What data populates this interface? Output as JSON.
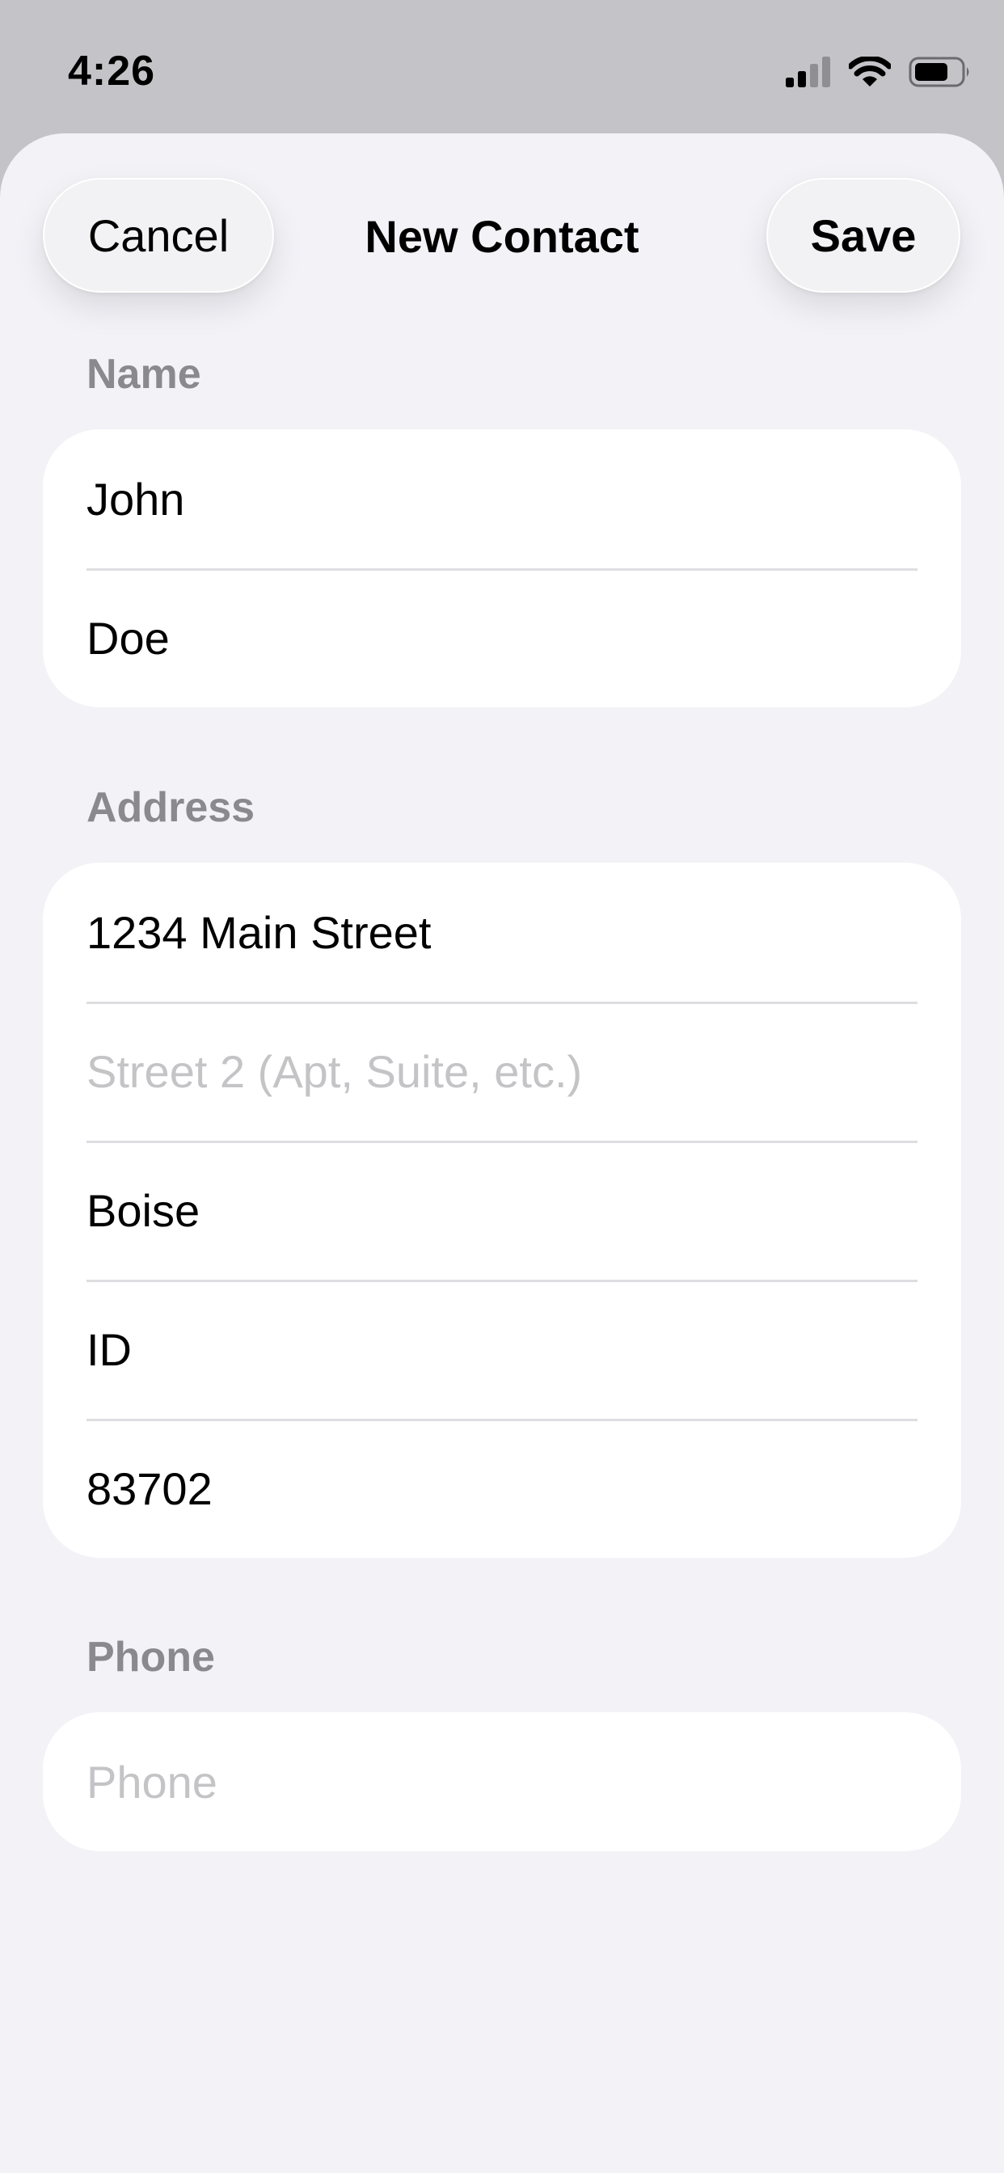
{
  "status_bar": {
    "time": "4:26",
    "icons": [
      "cellular-signal-icon",
      "wifi-icon",
      "battery-icon"
    ]
  },
  "nav": {
    "cancel_label": "Cancel",
    "title": "New Contact",
    "save_label": "Save"
  },
  "sections": {
    "name": {
      "header": "Name",
      "first_name": {
        "value": "John",
        "placeholder": ""
      },
      "last_name": {
        "value": "Doe",
        "placeholder": ""
      }
    },
    "address": {
      "header": "Address",
      "street1": {
        "value": "1234 Main Street",
        "placeholder": ""
      },
      "street2": {
        "value": "",
        "placeholder": "Street 2 (Apt, Suite, etc.)"
      },
      "city": {
        "value": "Boise",
        "placeholder": ""
      },
      "state": {
        "value": "ID",
        "placeholder": ""
      },
      "zip": {
        "value": "83702",
        "placeholder": ""
      }
    },
    "phone": {
      "header": "Phone",
      "phone": {
        "value": "",
        "placeholder": "Phone"
      }
    }
  },
  "colors": {
    "backdrop": "#c3c3c8",
    "sheet_background": "#f2f2f7",
    "section_header": "#8a8a8e",
    "placeholder": "#c4c4c7",
    "separator": "#dedee2"
  }
}
